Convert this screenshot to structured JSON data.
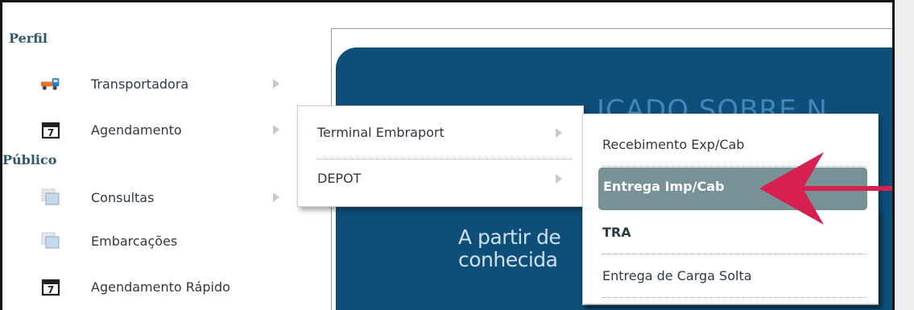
{
  "sidebar": {
    "section_perfil": "Perfil",
    "section_publico": "Público",
    "items": [
      {
        "label": "Transportadora",
        "icon": "truck-icon"
      },
      {
        "label": "Agendamento",
        "icon": "calendar-icon"
      },
      {
        "label": "Consultas",
        "icon": "window-icon"
      },
      {
        "label": "Embarcações",
        "icon": "window-icon"
      },
      {
        "label": "Agendamento Rápido",
        "icon": "calendar-icon"
      }
    ],
    "calendar_number": "7"
  },
  "submenu_level1": {
    "items": [
      {
        "label": "Terminal Embraport"
      },
      {
        "label": "DEPOT"
      }
    ]
  },
  "submenu_level2": {
    "items": [
      {
        "label": "Recebimento Exp/Cab"
      },
      {
        "label": "Entrega Imp/Cab"
      },
      {
        "label": "TRA"
      },
      {
        "label": "Entrega de Carga Solta"
      }
    ],
    "selected_index": 1
  },
  "banner": {
    "title_visible": "ICADO SOBRE N",
    "line1": "A partir de",
    "line2": "conhecida"
  },
  "colors": {
    "banner": "#0d4f79",
    "highlight": "#779295",
    "pointer_arrow": "#d6204f",
    "section_title": "#2d5870"
  }
}
